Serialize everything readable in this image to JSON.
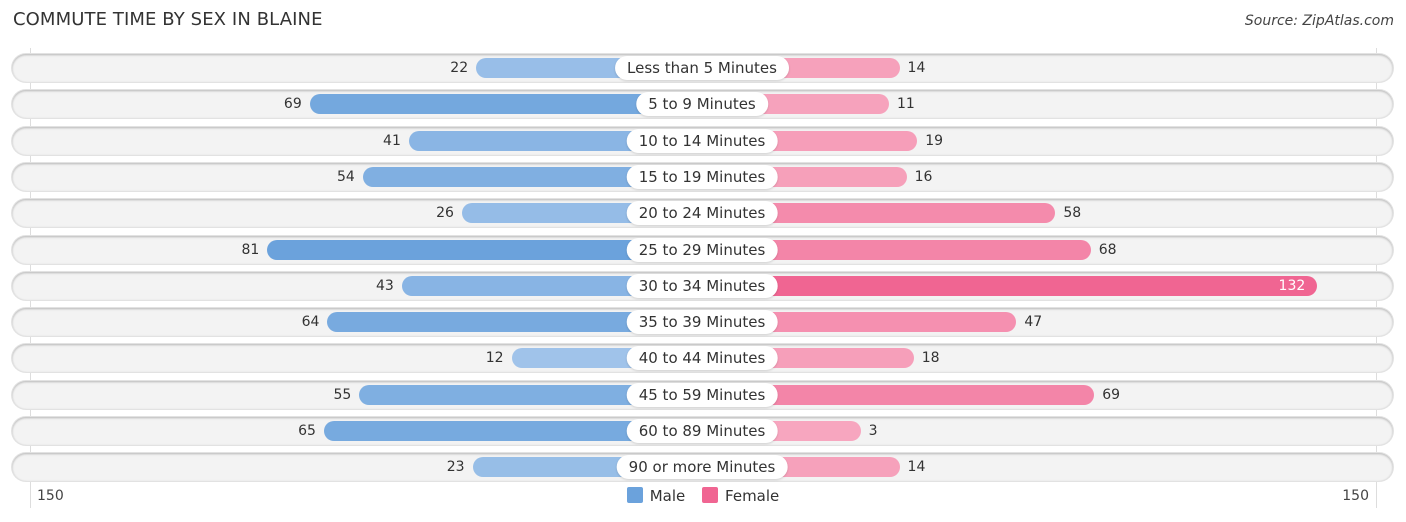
{
  "header": {
    "title": "COMMUTE TIME BY SEX IN BLAINE",
    "source": "Source: ZipAtlas.com"
  },
  "colors": {
    "male": "#6ba2dc",
    "male_light": "#a9c9ec",
    "female": "#f06592",
    "female_light": "#f7a8c0"
  },
  "chart_data": {
    "type": "bar",
    "orientation": "horizontal-diverging",
    "title": "COMMUTE TIME BY SEX IN BLAINE",
    "categories": [
      "Less than 5 Minutes",
      "5 to 9 Minutes",
      "10 to 14 Minutes",
      "15 to 19 Minutes",
      "20 to 24 Minutes",
      "25 to 29 Minutes",
      "30 to 34 Minutes",
      "35 to 39 Minutes",
      "40 to 44 Minutes",
      "45 to 59 Minutes",
      "60 to 89 Minutes",
      "90 or more Minutes"
    ],
    "series": [
      {
        "name": "Male",
        "values": [
          22,
          69,
          41,
          54,
          26,
          81,
          43,
          64,
          12,
          55,
          65,
          23
        ]
      },
      {
        "name": "Female",
        "values": [
          14,
          11,
          19,
          16,
          58,
          68,
          132,
          47,
          18,
          69,
          3,
          14
        ]
      }
    ],
    "axis": {
      "left_label": "150",
      "right_label": "150",
      "max": 150
    },
    "legend": {
      "position": "bottom-center",
      "items": [
        "Male",
        "Female"
      ]
    }
  }
}
